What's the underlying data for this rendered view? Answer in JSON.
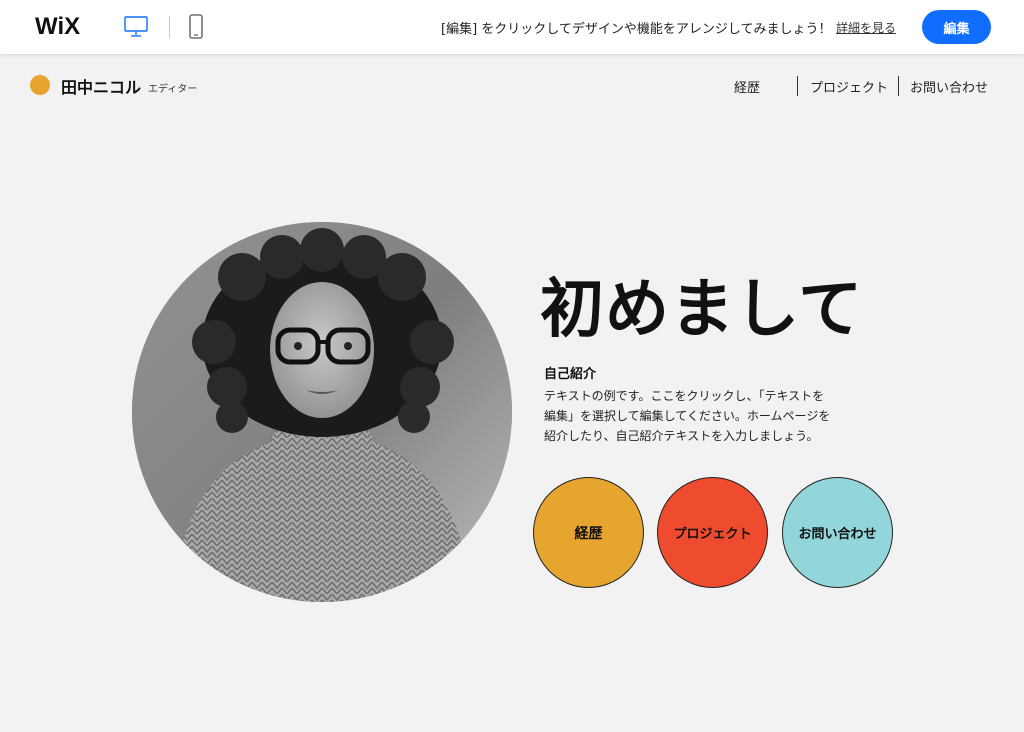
{
  "editor_bar": {
    "logo": "WiX",
    "banner": "[編集] をクリックしてデザインや機能をアレンジしてみましょう！",
    "details_link": "詳細を見る",
    "edit_button": "編集",
    "device_icons": [
      "desktop-icon",
      "mobile-icon"
    ],
    "accent_color": "#116dff"
  },
  "site_header": {
    "name": "田中ニコル",
    "role": "エディター",
    "brand_dot_color": "#e5a52e",
    "nav": [
      {
        "label": "経歴"
      },
      {
        "label": "プロジェクト"
      },
      {
        "label": "お問い合わせ"
      }
    ]
  },
  "hero": {
    "title": "初めまして",
    "about_heading": "自己紹介",
    "about_lines": [
      "テキストの例です。ここをクリックし、「テキストを",
      "編集」を選択して編集してください。ホームページを",
      "紹介したり、自己紹介テキストを入力しましょう。"
    ],
    "buttons": [
      {
        "label": "経歴",
        "color": "#e5a52e"
      },
      {
        "label": "プロジェクト",
        "color": "#ef4b2f"
      },
      {
        "label": "お問い合わせ",
        "color": "#92d5da"
      }
    ]
  }
}
